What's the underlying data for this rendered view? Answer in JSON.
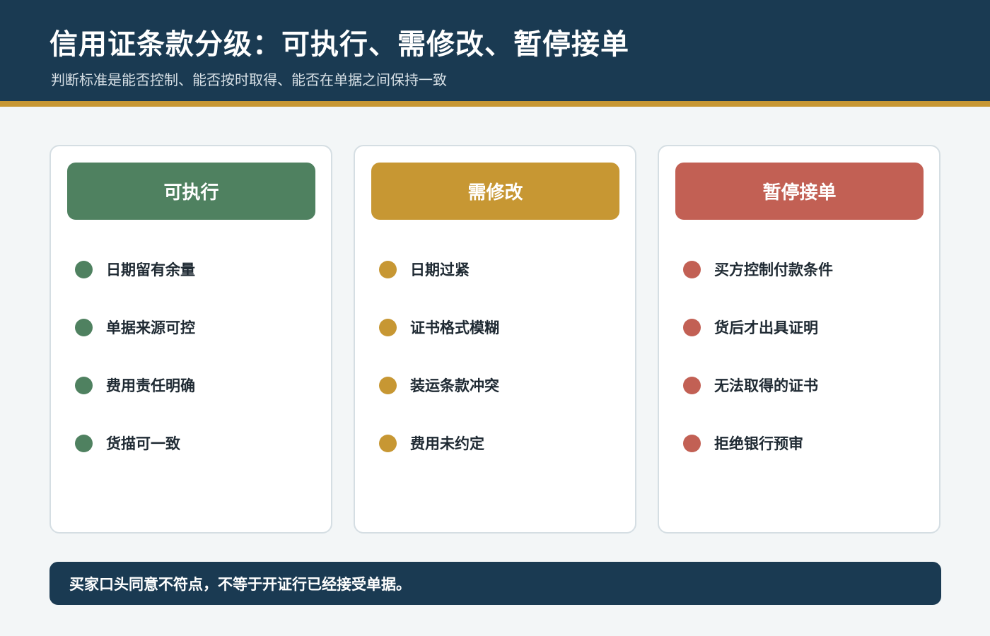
{
  "header": {
    "title": "信用证条款分级：可执行、需修改、暂停接单",
    "subtitle": "判断标准是能否控制、能否按时取得、能否在单据之间保持一致"
  },
  "colors": {
    "header_bg": "#1a3a52",
    "accent": "#c79733",
    "green": "#4f8160",
    "gold": "#c79733",
    "red": "#c26054"
  },
  "cards": [
    {
      "title": "可执行",
      "color": "#4f8160",
      "items": [
        "日期留有余量",
        "单据来源可控",
        "费用责任明确",
        "货描可一致"
      ]
    },
    {
      "title": "需修改",
      "color": "#c79733",
      "items": [
        "日期过紧",
        "证书格式模糊",
        "装运条款冲突",
        "费用未约定"
      ]
    },
    {
      "title": "暂停接单",
      "color": "#c26054",
      "items": [
        "买方控制付款条件",
        "货后才出具证明",
        "无法取得的证书",
        "拒绝银行预审"
      ]
    }
  ],
  "footer": {
    "note": "买家口头同意不符点，不等于开证行已经接受单据。"
  }
}
